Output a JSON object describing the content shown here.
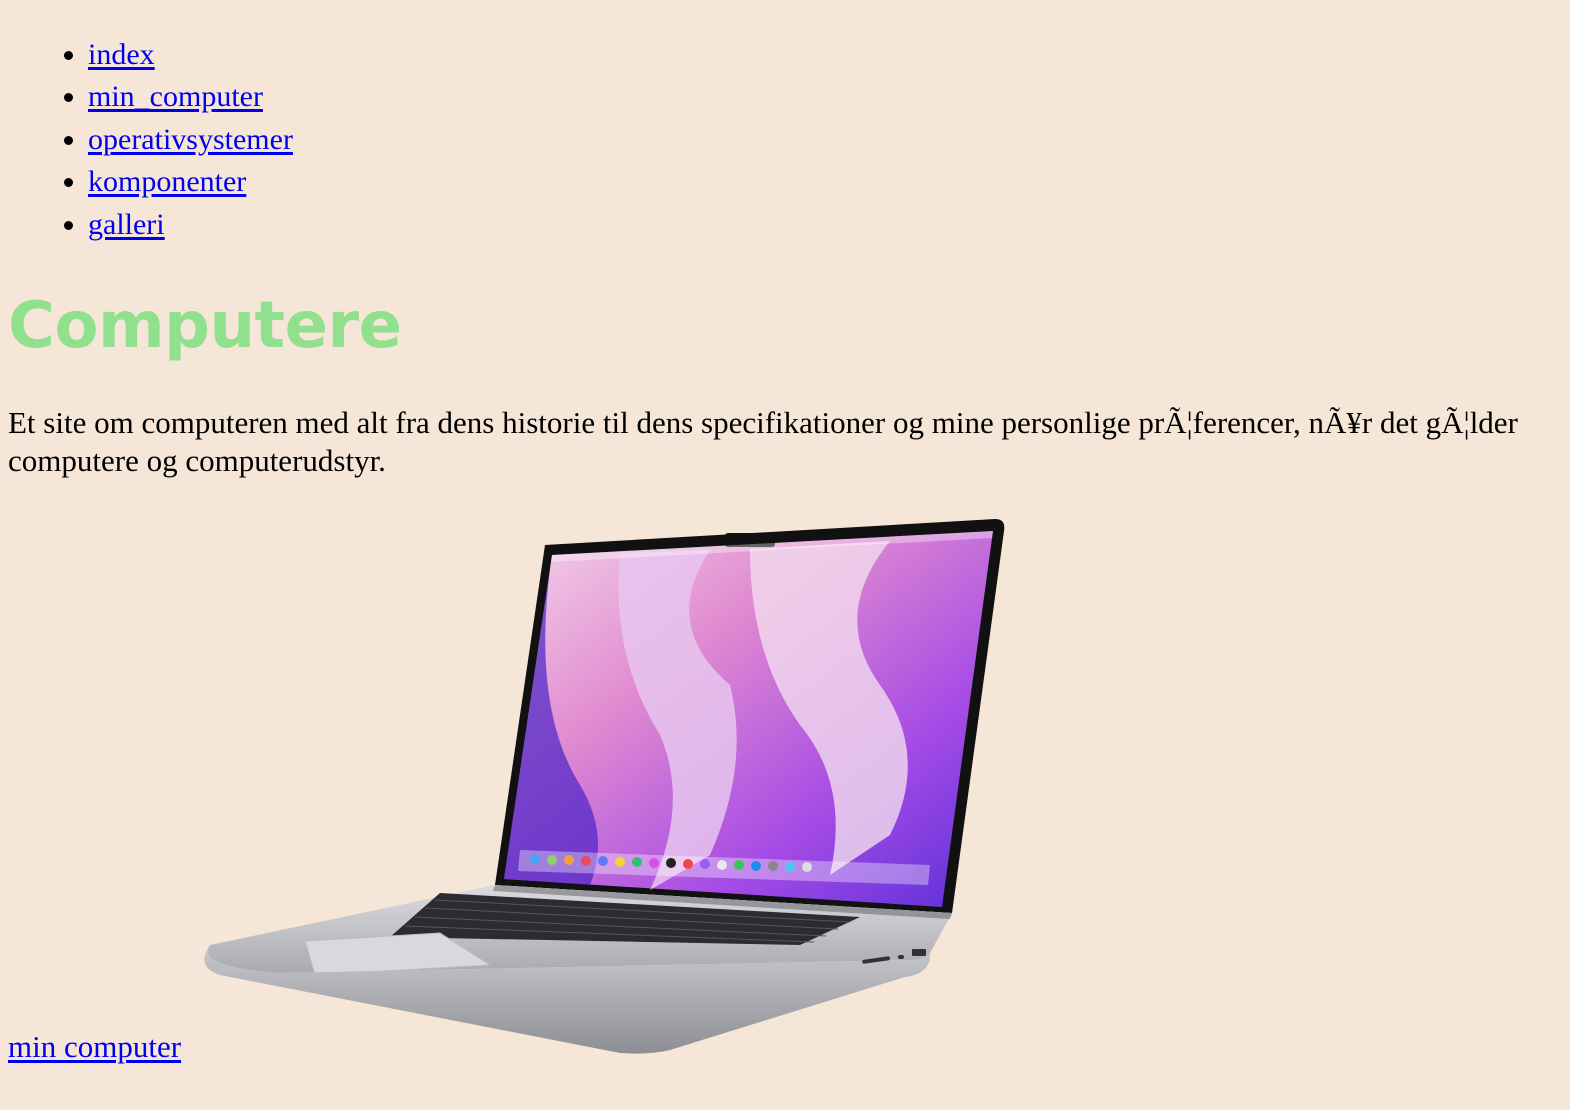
{
  "nav": {
    "items": [
      {
        "label": "index"
      },
      {
        "label": "min_computer"
      },
      {
        "label": "operativsystemer"
      },
      {
        "label": "komponenter"
      },
      {
        "label": "galleri"
      }
    ]
  },
  "page": {
    "title": "Computere",
    "intro": "Et site om computeren med alt fra dens historie til dens specifikationer og mine personlige prÃ¦ferencer, nÃ¥r det gÃ¦lder computere og computerudstyr."
  },
  "hero": {
    "icon": "laptop-image"
  },
  "footer": {
    "link_label": "min computer"
  },
  "colors": {
    "background": "#f5e6d8",
    "title": "#90e08e",
    "link": "#0000ee"
  }
}
